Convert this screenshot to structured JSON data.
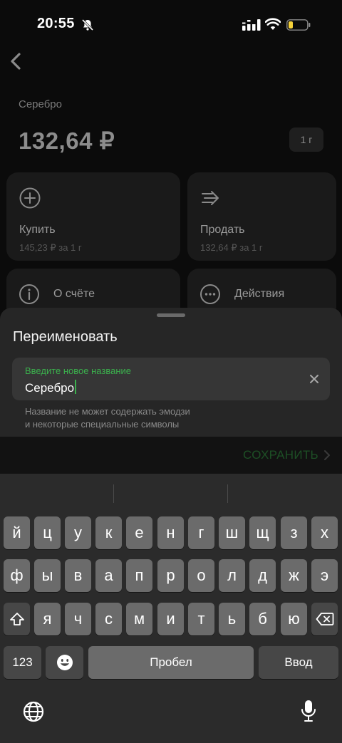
{
  "status": {
    "time": "20:55"
  },
  "asset": {
    "name": "Серебро",
    "price": "132,64 ₽",
    "unit": "1 г"
  },
  "cards": {
    "buy": {
      "title": "Купить",
      "subtitle": "145,23 ₽ за 1 г"
    },
    "sell": {
      "title": "Продать",
      "subtitle": "132,64 ₽ за 1 г"
    },
    "info": {
      "label": "О счёте"
    },
    "actions": {
      "label": "Действия"
    }
  },
  "sheet": {
    "title": "Переименовать",
    "field": {
      "label": "Введите новое название",
      "value": "Серебро"
    },
    "hint_line1": "Название не может содержать эмодзи",
    "hint_line2": "и некоторые специальные символы",
    "save_label": "СОХРАНИТЬ"
  },
  "keyboard": {
    "row1": [
      "й",
      "ц",
      "у",
      "к",
      "е",
      "н",
      "г",
      "ш",
      "щ",
      "з",
      "х"
    ],
    "row2": [
      "ф",
      "ы",
      "в",
      "а",
      "п",
      "р",
      "о",
      "л",
      "д",
      "ж",
      "э"
    ],
    "row3": [
      "я",
      "ч",
      "с",
      "м",
      "и",
      "т",
      "ь",
      "б",
      "ю"
    ],
    "numbers_label": "123",
    "space_label": "Пробел",
    "return_label": "Ввод"
  },
  "colors": {
    "accent_green": "#3bb04d",
    "sheet_bg": "#262626",
    "keyboard_bg": "#2b2b2b"
  }
}
